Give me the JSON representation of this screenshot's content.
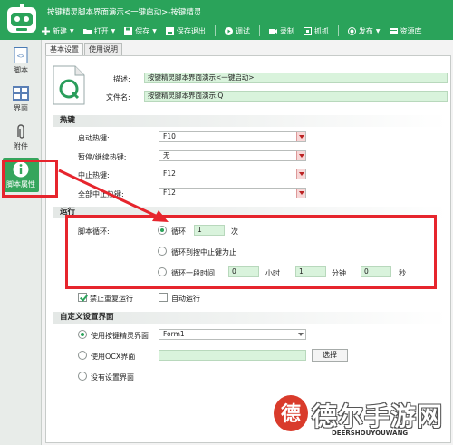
{
  "window": {
    "title": "按键精灵脚本界面演示<一键启动>-按键精灵"
  },
  "toolbar": {
    "new": "新建",
    "open": "打开",
    "save": "保存",
    "save_exit": "保存退出",
    "debug": "调试",
    "record": "录制",
    "capture": "抓抓",
    "publish": "发布",
    "resources": "资源库"
  },
  "sidebar": {
    "items": [
      {
        "label": "脚本"
      },
      {
        "label": "界面"
      },
      {
        "label": "附件"
      },
      {
        "label": "脚本属性",
        "active": true
      }
    ]
  },
  "tabs": [
    {
      "label": "基本设置"
    },
    {
      "label": "使用说明"
    }
  ],
  "info": {
    "desc_label": "描述:",
    "desc_value": "按键精灵脚本界面演示<一键启动>",
    "file_label": "文件名:",
    "file_value": "按键精灵脚本界面演示.Q",
    "icon_letter": "Q"
  },
  "hotkeys": {
    "heading": "热键",
    "start_label": "启动热键:",
    "start_value": "F10",
    "pause_label": "暂停/继续热键:",
    "pause_value": "无",
    "stop_label": "中止热键:",
    "stop_value": "F12",
    "stop_all_label": "全部中止热键:",
    "stop_all_value": "F12"
  },
  "run": {
    "heading": "运行",
    "loop_label": "脚本循环:",
    "opt_loop": "循环",
    "loop_count": "1",
    "loop_unit": "次",
    "opt_until_stop": "循环到按中止键为止",
    "opt_duration": "循环一段时间",
    "hours": "0",
    "hours_unit": "小时",
    "minutes": "1",
    "minutes_unit": "分钟",
    "seconds": "0",
    "seconds_unit": "秒",
    "no_repeat": "禁止重复运行",
    "auto_run": "自动运行"
  },
  "custom_ui": {
    "heading": "自定义设置界面",
    "opt_builtin": "使用按键精灵界面",
    "form_value": "Form1",
    "opt_ocx": "使用OCX界面",
    "ocx_value": "",
    "select_button": "选择",
    "opt_none": "没有设置界面"
  },
  "watermark": {
    "chinese": "德尔手游网",
    "english": "DEERSHOUYOUWANG"
  },
  "colors": {
    "titlebar": "#2aa35a",
    "highlight": "#e6252d",
    "field_bg": "#d9f3dc"
  }
}
